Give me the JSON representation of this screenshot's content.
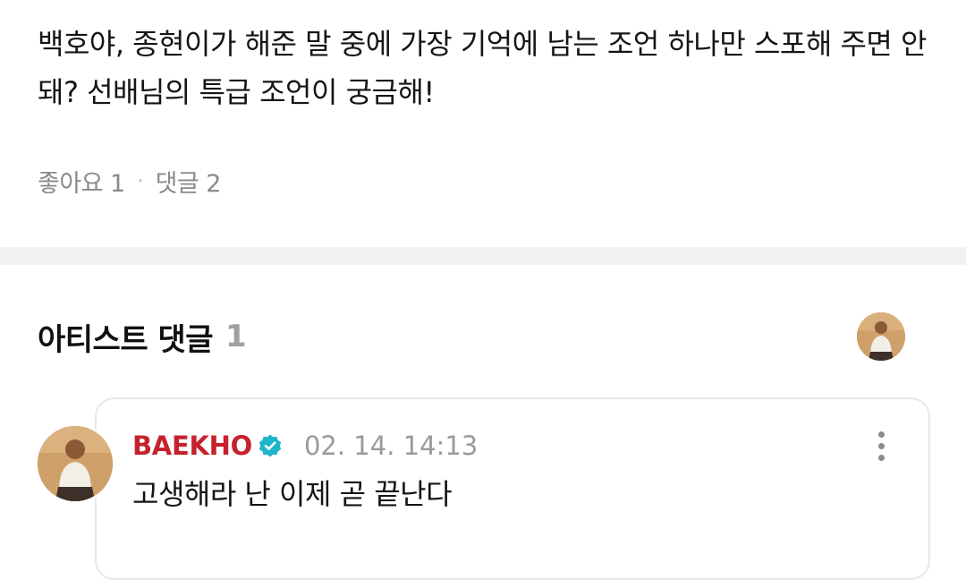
{
  "post": {
    "body": "백호야, 종현이가 해준 말 중에 가장 기억에 남는 조언 하나만 스포해 주면 안 돼? 선배님의 특급 조언이 궁금해!",
    "likes_label": "좋아요",
    "likes_count": "1",
    "separator": "·",
    "comments_label": "댓글",
    "comments_count": "2"
  },
  "artist_comments": {
    "title": "아티스트 댓글",
    "count": "1"
  },
  "comment": {
    "author": "BAEKHO",
    "timestamp": "02. 14. 14:13",
    "text": "고생해라 난 이제 곧 끝난다",
    "verified_icon": "verified-badge-icon",
    "more_icon": "more-vertical-icon"
  },
  "colors": {
    "author": "#c5222e",
    "verified": "#1fb5c9",
    "divider": "#f2f2f4"
  }
}
